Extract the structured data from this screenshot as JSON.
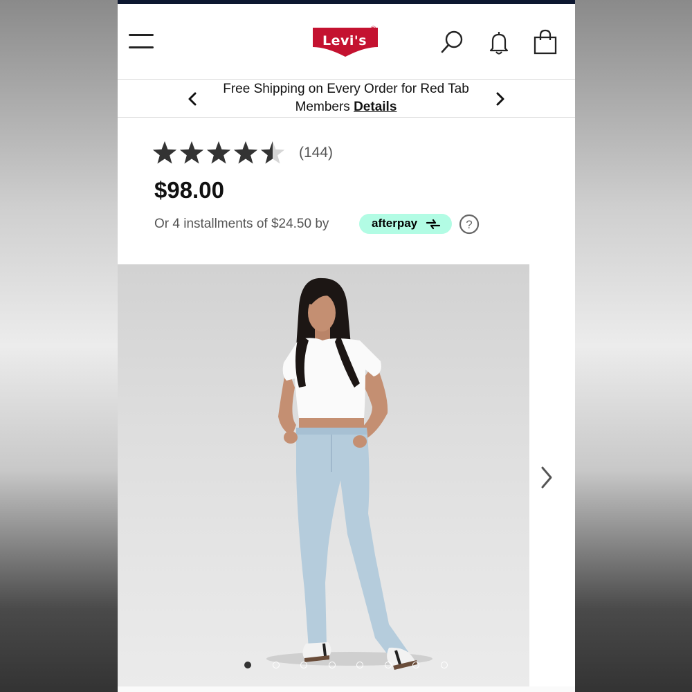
{
  "header": {
    "brand": "Levi's",
    "brand_mark": "®",
    "brand_color": "#c41230",
    "icons": [
      "menu-icon",
      "search-icon",
      "bell-icon",
      "shopping-bag-icon"
    ]
  },
  "promo": {
    "message": "Free Shipping on Every Order for Red Tab Members",
    "link": "Details"
  },
  "product": {
    "rating": 4.5,
    "rating_max": 5,
    "review_count": "(144)",
    "price": "$98.00",
    "installments_text": "Or 4 installments of $24.50 by",
    "afterpay_label": "afterpay",
    "afterpay_color": "#b2fce4"
  },
  "gallery": {
    "image_count": 8,
    "active_index": 0
  }
}
